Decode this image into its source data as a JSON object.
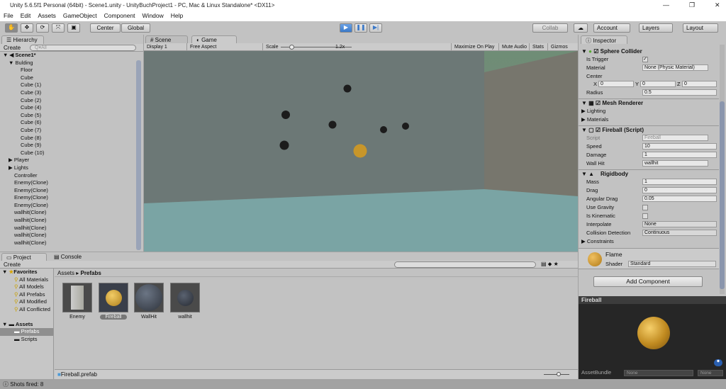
{
  "window": {
    "title": "Unity 5.6.5f1 Personal (64bit) - Scene1.unity - UnityBuchProject1 - PC, Mac & Linux Standalone* <DX11>"
  },
  "menu": [
    "File",
    "Edit",
    "Assets",
    "GameObject",
    "Component",
    "Window",
    "Help"
  ],
  "toolbar": {
    "center": "Center",
    "global": "Global",
    "collab": "Collab",
    "account": "Account",
    "layers": "Layers",
    "layout": "Layout"
  },
  "hierarchy": {
    "tab": "Hierarchy",
    "create": "Create",
    "search_placeholder": "All",
    "scene": "Scene1*",
    "items": [
      {
        "label": "Bulding",
        "indent": 1,
        "arrow": "▼"
      },
      {
        "label": "Floor",
        "indent": 2
      },
      {
        "label": "Cube",
        "indent": 2
      },
      {
        "label": "Cube (1)",
        "indent": 2
      },
      {
        "label": "Cube (3)",
        "indent": 2
      },
      {
        "label": "Cube (2)",
        "indent": 2
      },
      {
        "label": "Cube (4)",
        "indent": 2
      },
      {
        "label": "Cube (5)",
        "indent": 2
      },
      {
        "label": "Cube (6)",
        "indent": 2
      },
      {
        "label": "Cube (7)",
        "indent": 2
      },
      {
        "label": "Cube (8)",
        "indent": 2
      },
      {
        "label": "Cube (9)",
        "indent": 2
      },
      {
        "label": "Cube (10)",
        "indent": 2
      },
      {
        "label": "Player",
        "indent": 1,
        "arrow": "▶"
      },
      {
        "label": "Lights",
        "indent": 1,
        "arrow": "▶"
      },
      {
        "label": "Controller",
        "indent": 1
      },
      {
        "label": "Enemy(Clone)",
        "indent": 1
      },
      {
        "label": "Enemy(Clone)",
        "indent": 1
      },
      {
        "label": "Enemy(Clone)",
        "indent": 1
      },
      {
        "label": "Enemy(Clone)",
        "indent": 1
      },
      {
        "label": "wallhit(Clone)",
        "indent": 1
      },
      {
        "label": "wallhit(Clone)",
        "indent": 1
      },
      {
        "label": "wallhit(Clone)",
        "indent": 1
      },
      {
        "label": "wallhit(Clone)",
        "indent": 1
      },
      {
        "label": "wallhit(Clone)",
        "indent": 1
      }
    ]
  },
  "game": {
    "tab_scene": "Scene",
    "tab_game": "Game",
    "display": "Display 1",
    "aspect": "Free Aspect",
    "scale_label": "Scale",
    "scale_value": "1.2x",
    "maximize": "Maximize On Play",
    "mute": "Mute Audio",
    "stats": "Stats",
    "gizmos": "Gizmos"
  },
  "inspector": {
    "tab": "Inspector",
    "sphere_collider": {
      "title": "Sphere Collider",
      "is_trigger": "Is Trigger",
      "material": "Material",
      "material_value": "None (Physic Material)",
      "center": "Center",
      "x": "X",
      "y": "Y",
      "z": "Z",
      "cx": "0",
      "cy": "0",
      "cz": "0",
      "radius": "Radius",
      "radius_value": "0.5"
    },
    "mesh_renderer": {
      "title": "Mesh Renderer",
      "lighting": "Lighting",
      "materials": "Materials"
    },
    "script": {
      "title": "Fireball (Script)",
      "script": "Script",
      "script_value": "Fireball",
      "speed": "Speed",
      "speed_value": "10",
      "damage": "Damage",
      "damage_value": "1",
      "wall_hit": "Wall Hit",
      "wall_hit_value": "wallhit"
    },
    "rigidbody": {
      "title": "Rigidbody",
      "mass": "Mass",
      "mass_value": "1",
      "drag": "Drag",
      "drag_value": "0",
      "angular_drag": "Angular Drag",
      "angular_drag_value": "0.05",
      "use_gravity": "Use Gravity",
      "is_kinematic": "Is Kinematic",
      "interpolate": "Interpolate",
      "interpolate_value": "None",
      "collision": "Collision Detection",
      "collision_value": "Continuous",
      "constraints": "Constraints"
    },
    "material": {
      "name": "Flame",
      "shader": "Shader",
      "shader_value": "Standard"
    },
    "add_component": "Add Component",
    "preview_title": "Fireball",
    "asset_bundle": "AssetBundle",
    "bundle_value": "None",
    "variant_value": "None"
  },
  "project": {
    "tab_project": "Project",
    "tab_console": "Console",
    "create": "Create",
    "favorites": "Favorites",
    "fav_items": [
      "All Materials",
      "All Models",
      "All Prefabs",
      "All Modified",
      "All Conflicted"
    ],
    "assets": "Assets",
    "folders": [
      "Prefabs",
      "Scripts"
    ],
    "breadcrumb_root": "Assets",
    "breadcrumb_current": "Prefabs",
    "items": [
      "Enemy",
      "Fireball",
      "WallHit",
      "wallhit"
    ],
    "selected_file": "Fireball.prefab"
  },
  "status": {
    "message": "Shots fired: 8"
  },
  "colors": {
    "accent": "#3a78c8",
    "fireball": "#c8962a",
    "panel": "#c2c2c2"
  }
}
